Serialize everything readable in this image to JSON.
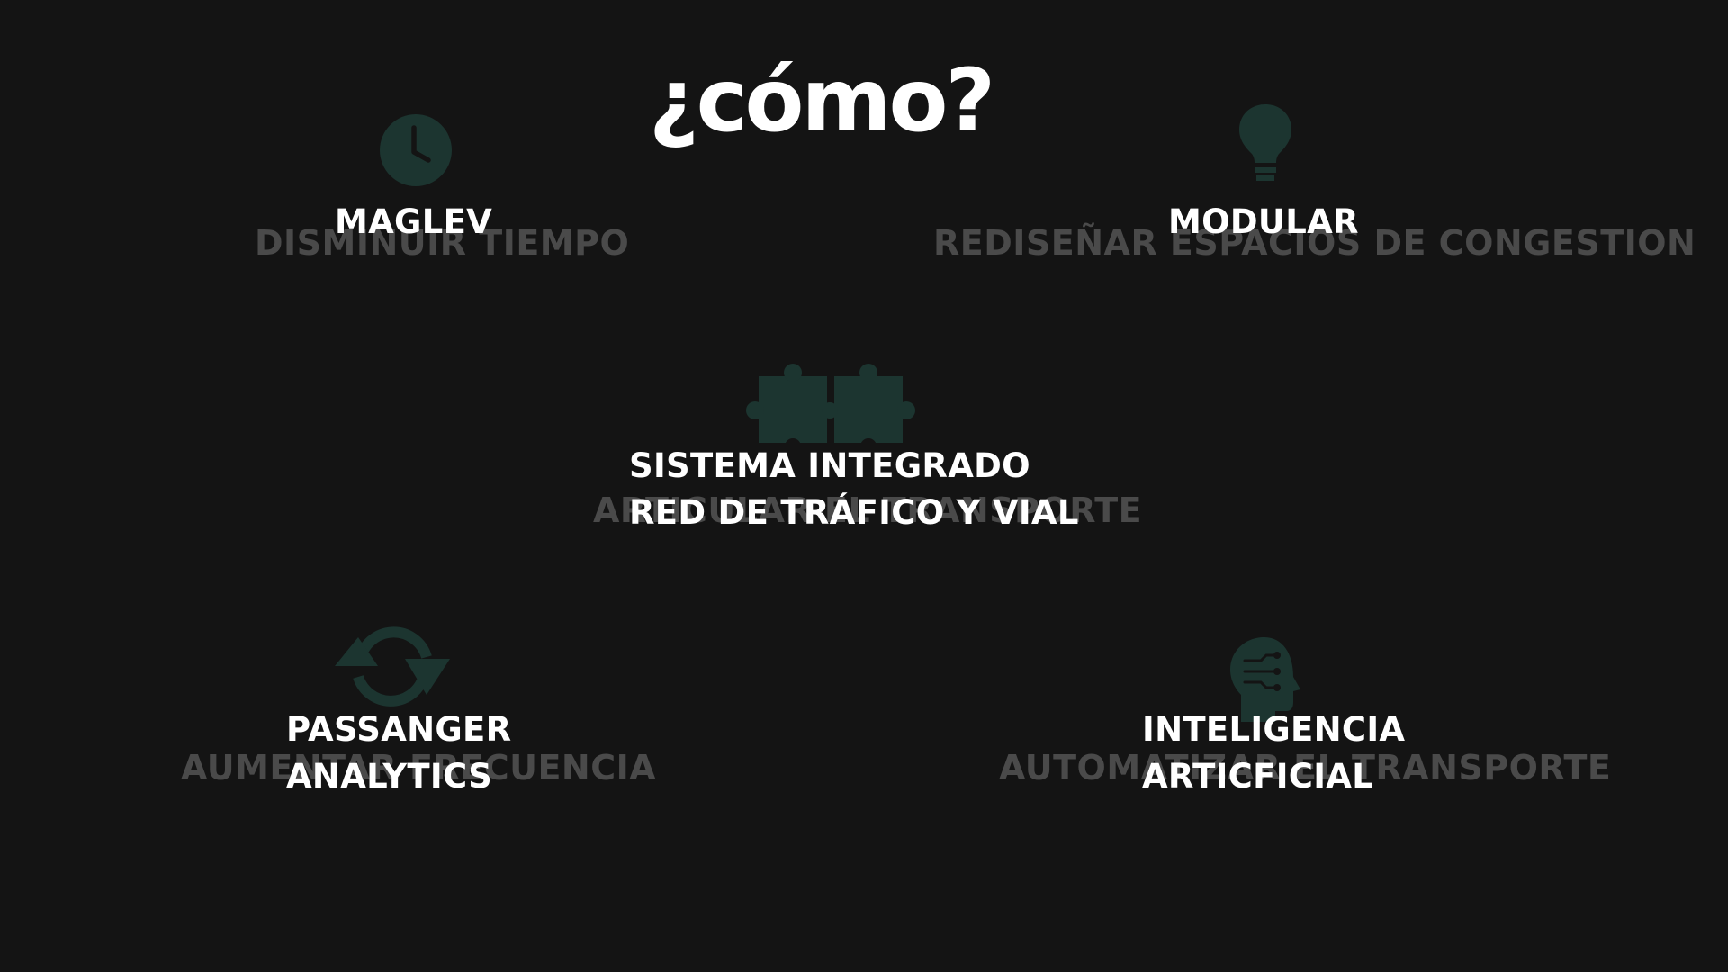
{
  "title": "¿cómo?",
  "colors": {
    "background": "#141414",
    "icon": "#1c3530",
    "ghost_text": "#4a4a4a",
    "label_text": "#ffffff"
  },
  "items": [
    {
      "icon": "clock-icon",
      "ghost": "DISMINUIR TIEMPO",
      "label_lines": [
        "MAGLEV"
      ]
    },
    {
      "icon": "lightbulb-icon",
      "ghost": "REDISEÑAR ESPACIOS DE CONGESTION",
      "label_lines": [
        "MODULAR"
      ]
    },
    {
      "icon": "puzzle-icon",
      "ghost": "ARTICULAR EL TRANSPORTE",
      "label_lines": [
        "SISTEMA INTEGRADO",
        "RED DE TRÁFICO Y VIAL"
      ]
    },
    {
      "icon": "refresh-icon",
      "ghost": "AUMENTAR FRECUENCIA",
      "label_lines": [
        "PASSANGER",
        "ANALYTICS"
      ]
    },
    {
      "icon": "ai-head-icon",
      "ghost": "AUTOMATIZAR EL TRANSPORTE",
      "label_lines": [
        "INTELIGENCIA",
        "ARTICFICIAL"
      ]
    }
  ]
}
